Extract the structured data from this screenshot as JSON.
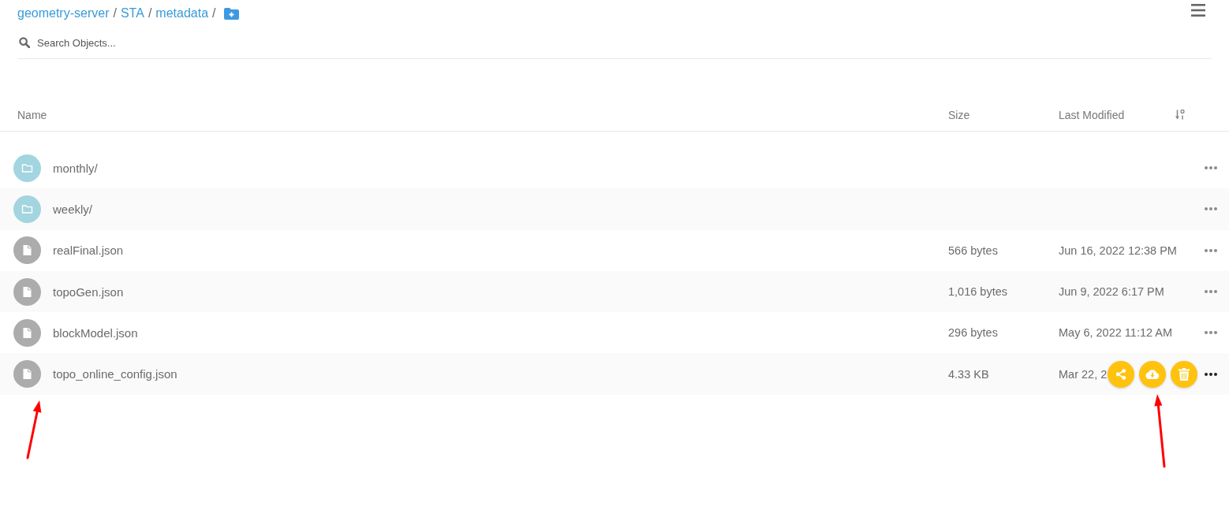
{
  "breadcrumb": {
    "segments": [
      {
        "label": "geometry-server",
        "separator": "/"
      },
      {
        "label": "STA",
        "separator": "/"
      },
      {
        "label": "metadata",
        "separator": "/"
      }
    ]
  },
  "search": {
    "placeholder": "Search Objects..."
  },
  "table": {
    "columns": [
      {
        "label": "Name"
      },
      {
        "label": "Size"
      },
      {
        "label": "Last Modified",
        "sorted": true
      }
    ],
    "rows": [
      {
        "kind": "folder",
        "name": "monthly/",
        "hovered": false
      },
      {
        "kind": "folder",
        "name": "weekly/",
        "hovered": false
      },
      {
        "kind": "file",
        "name": "realFinal.json",
        "size": "566 bytes",
        "modified": "Jun 16, 2022 12:38 PM",
        "hovered": false
      },
      {
        "kind": "file",
        "name": "topoGen.json",
        "size": "1,016 bytes",
        "modified": "Jun 9, 2022 6:17 PM",
        "hovered": false
      },
      {
        "kind": "file",
        "name": "blockModel.json",
        "size": "296 bytes",
        "modified": "May 6, 2022 11:12 AM",
        "hovered": false
      },
      {
        "kind": "file",
        "name": "topo_online_config.json",
        "size": "4.33 KB",
        "modified": "Mar 22, 2",
        "hovered": true,
        "actions": [
          {
            "kind": "share"
          },
          {
            "kind": "download"
          },
          {
            "kind": "delete"
          }
        ]
      }
    ]
  }
}
